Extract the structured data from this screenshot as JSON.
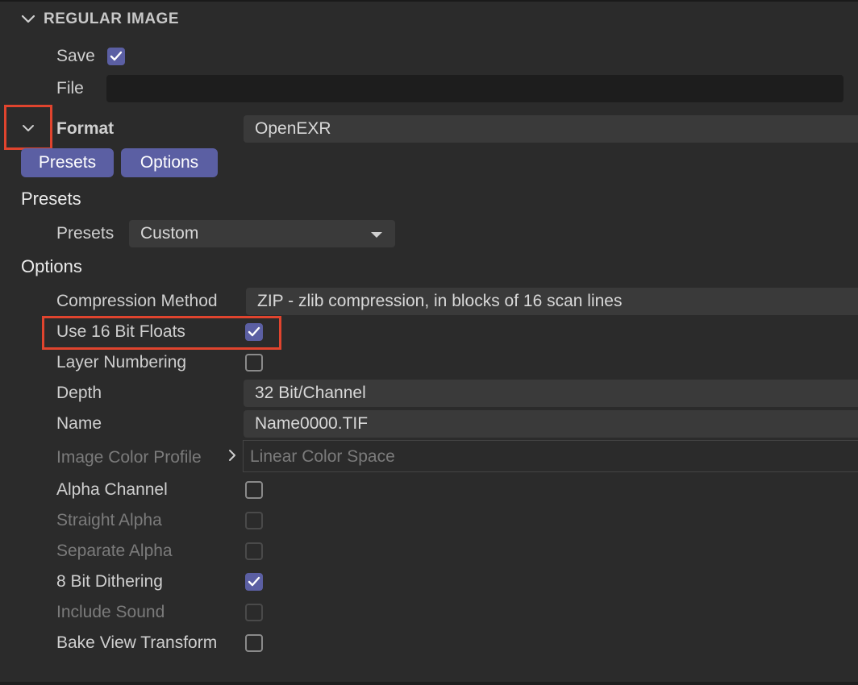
{
  "section": {
    "title": "REGULAR IMAGE"
  },
  "save": {
    "label": "Save",
    "checked": true
  },
  "file": {
    "label": "File",
    "value": ""
  },
  "format": {
    "label": "Format",
    "value": "OpenEXR"
  },
  "tabs": {
    "presets": "Presets",
    "options": "Options"
  },
  "presets_section": {
    "heading": "Presets",
    "label": "Presets",
    "value": "Custom"
  },
  "options_section": {
    "heading": "Options",
    "rows": {
      "compression": {
        "label": "Compression Method",
        "value": "ZIP - zlib compression, in blocks of 16 scan lines"
      },
      "use16": {
        "label": "Use 16 Bit Floats",
        "checked": true
      },
      "layer_numbering": {
        "label": "Layer Numbering",
        "checked": false
      },
      "depth": {
        "label": "Depth",
        "value": "32 Bit/Channel"
      },
      "name": {
        "label": "Name",
        "value": "Name0000.TIF"
      },
      "color_profile": {
        "label": "Image Color Profile",
        "value": "Linear Color Space",
        "disabled": true
      },
      "alpha_channel": {
        "label": "Alpha Channel",
        "checked": false
      },
      "straight_alpha": {
        "label": "Straight Alpha",
        "checked": false,
        "disabled": true
      },
      "separate_alpha": {
        "label": "Separate Alpha",
        "checked": false,
        "disabled": true
      },
      "dithering": {
        "label": "8 Bit Dithering",
        "checked": true
      },
      "include_sound": {
        "label": "Include Sound",
        "checked": false,
        "disabled": true
      },
      "bake_view": {
        "label": "Bake View Transform",
        "checked": false
      }
    }
  },
  "colors": {
    "background": "#2b2b2b",
    "accent": "#5b5fa3",
    "field": "#3a3a3a",
    "highlight": "#e0442e"
  },
  "icons": {
    "section_toggle": "chevron-down-icon",
    "format_toggle": "chevron-down-icon",
    "dropdown": "triangle-down-icon",
    "profile_expand": "chevron-right-icon",
    "check": "checkmark-icon"
  }
}
